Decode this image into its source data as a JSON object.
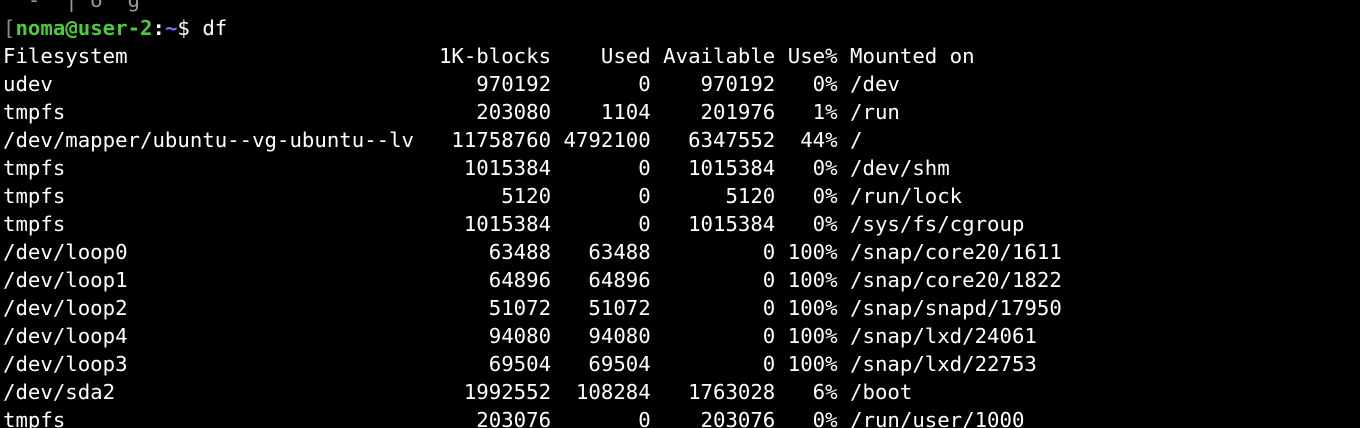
{
  "terminal": {
    "top_fragment": "  -  | o  g",
    "prompt": {
      "bracket": "[",
      "user_host": "noma@user-2",
      "colon": ":",
      "dir": "~",
      "dollar": "$ ",
      "command": "df"
    },
    "columns": [
      "Filesystem",
      "1K-blocks",
      "Used",
      "Available",
      "Use%",
      "Mounted on"
    ],
    "rows": [
      {
        "fs": "udev",
        "blocks": "970192",
        "used": "0",
        "avail": "970192",
        "pct": "0%",
        "mount": "/dev"
      },
      {
        "fs": "tmpfs",
        "blocks": "203080",
        "used": "1104",
        "avail": "201976",
        "pct": "1%",
        "mount": "/run"
      },
      {
        "fs": "/dev/mapper/ubuntu--vg-ubuntu--lv",
        "blocks": "11758760",
        "used": "4792100",
        "avail": "6347552",
        "pct": "44%",
        "mount": "/"
      },
      {
        "fs": "tmpfs",
        "blocks": "1015384",
        "used": "0",
        "avail": "1015384",
        "pct": "0%",
        "mount": "/dev/shm"
      },
      {
        "fs": "tmpfs",
        "blocks": "5120",
        "used": "0",
        "avail": "5120",
        "pct": "0%",
        "mount": "/run/lock"
      },
      {
        "fs": "tmpfs",
        "blocks": "1015384",
        "used": "0",
        "avail": "1015384",
        "pct": "0%",
        "mount": "/sys/fs/cgroup"
      },
      {
        "fs": "/dev/loop0",
        "blocks": "63488",
        "used": "63488",
        "avail": "0",
        "pct": "100%",
        "mount": "/snap/core20/1611"
      },
      {
        "fs": "/dev/loop1",
        "blocks": "64896",
        "used": "64896",
        "avail": "0",
        "pct": "100%",
        "mount": "/snap/core20/1822"
      },
      {
        "fs": "/dev/loop2",
        "blocks": "51072",
        "used": "51072",
        "avail": "0",
        "pct": "100%",
        "mount": "/snap/snapd/17950"
      },
      {
        "fs": "/dev/loop4",
        "blocks": "94080",
        "used": "94080",
        "avail": "0",
        "pct": "100%",
        "mount": "/snap/lxd/24061"
      },
      {
        "fs": "/dev/loop3",
        "blocks": "69504",
        "used": "69504",
        "avail": "0",
        "pct": "100%",
        "mount": "/snap/lxd/22753"
      },
      {
        "fs": "/dev/sda2",
        "blocks": "1992552",
        "used": "108284",
        "avail": "1763028",
        "pct": "6%",
        "mount": "/boot"
      },
      {
        "fs": "tmpfs",
        "blocks": "203076",
        "used": "0",
        "avail": "203076",
        "pct": "0%",
        "mount": "/run/user/1000"
      }
    ],
    "colors": {
      "background": "#000000",
      "text": "#ffffff",
      "prompt_user": "#4ec940",
      "prompt_dir": "#7b6cf5"
    }
  }
}
